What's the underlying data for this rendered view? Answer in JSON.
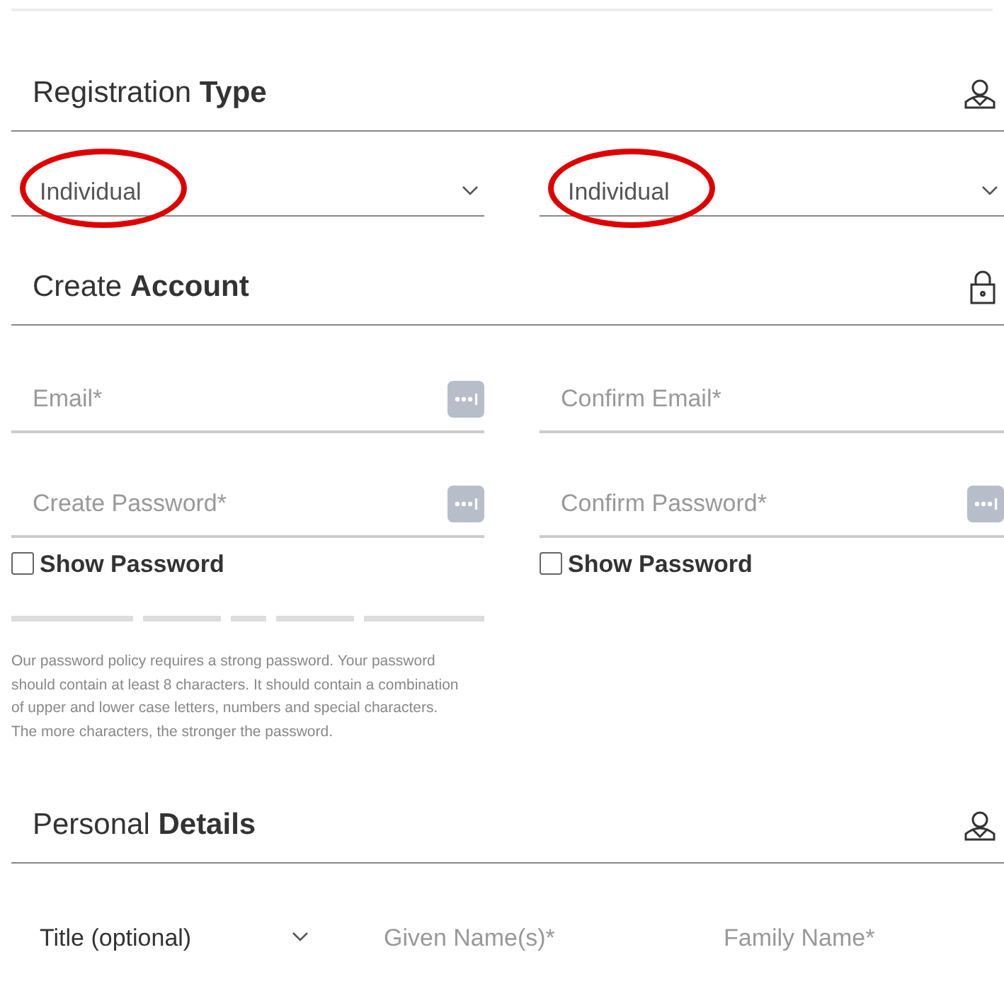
{
  "registration_type": {
    "heading": "Registration **Type**",
    "selects": [
      {
        "value": "Individual",
        "circled": true
      },
      {
        "value": "Individual",
        "circled": true
      }
    ]
  },
  "create_account": {
    "heading": "Create **Account**",
    "fields": [
      {
        "placeholder": "Email*",
        "key_icon": true
      },
      {
        "placeholder": "Confirm Email*",
        "key_icon": false
      },
      {
        "placeholder": "Create Password*",
        "key_icon": true
      },
      {
        "placeholder": "Confirm Password*",
        "key_icon": true
      }
    ],
    "show_password": [
      {
        "label": "Show Password",
        "checked": false
      },
      {
        "label": "Show Password",
        "checked": false
      }
    ],
    "policy": "Our password policy requires a strong password. Your password should contain at least 8 characters. It should contain a combination of upper and lower case letters, numbers and special characters. The more characters, the stronger the password."
  },
  "personal_details": {
    "heading": "Personal **Details**",
    "title_select": {
      "value": "Title (optional)"
    },
    "fields": [
      {
        "placeholder": "Given Name(s)*"
      },
      {
        "placeholder": "Family Name*"
      }
    ]
  }
}
